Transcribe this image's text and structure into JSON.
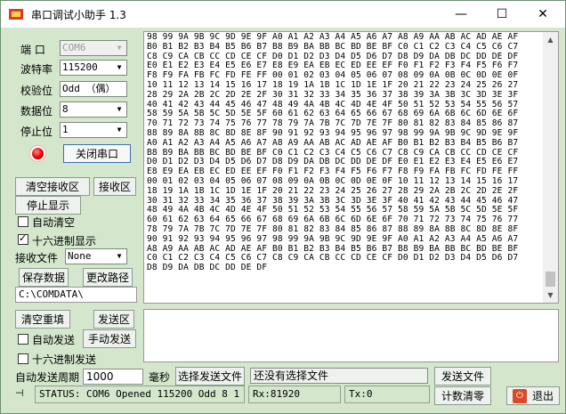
{
  "window": {
    "title": "串口调试小助手 1.3",
    "minimize_glyph": "—",
    "maximize_glyph": "☐",
    "close_glyph": "✕"
  },
  "settings": {
    "port_label": "端 口",
    "port_value": "COM6",
    "baud_label": "波特率",
    "baud_value": "115200",
    "parity_label": "校验位",
    "parity_value": "Odd （偶）",
    "databits_label": "数据位",
    "databits_value": "8",
    "stopbits_label": "停止位",
    "stopbits_value": "1",
    "close_port_button": "关闭串口"
  },
  "receive": {
    "clear_button": "清空接收区",
    "area_button": "接收区",
    "stop_button": "停止显示",
    "auto_clear_label": "自动清空",
    "auto_clear_checked": false,
    "hex_display_label": "十六进制显示",
    "hex_display_checked": true,
    "file_label": "接收文件",
    "file_value": "None",
    "save_button": "保存数据",
    "change_path_button": "更改路径",
    "path": "C:\\COMDATA\\",
    "lines": [
      "98 99 9A 9B 9C 9D 9E 9F A0 A1 A2 A3 A4 A5 A6 A7 A8 A9 AA AB AC AD AE AF",
      "B0 B1 B2 B3 B4 B5 B6 B7 B8 B9 BA BB BC BD BE BF C0 C1 C2 C3 C4 C5 C6 C7",
      "C8 C9 CA CB CC CD CE CF D0 D1 D2 D3 D4 D5 D6 D7 D8 D9 DA DB DC DD DE DF",
      "E0 E1 E2 E3 E4 E5 E6 E7 E8 E9 EA EB EC ED EE EF F0 F1 F2 F3 F4 F5 F6 F7",
      "F8 F9 FA FB FC FD FE FF 00 01 02 03 04 05 06 07 08 09 0A 0B 0C 0D 0E 0F",
      "10 11 12 13 14 15 16 17 18 19 1A 1B 1C 1D 1E 1F 20 21 22 23 24 25 26 27",
      "28 29 2A 2B 2C 2D 2E 2F 30 31 32 33 34 35 36 37 38 39 3A 3B 3C 3D 3E 3F",
      "40 41 42 43 44 45 46 47 48 49 4A 4B 4C 4D 4E 4F 50 51 52 53 54 55 56 57",
      "58 59 5A 5B 5C 5D 5E 5F 60 61 62 63 64 65 66 67 68 69 6A 6B 6C 6D 6E 6F",
      "70 71 72 73 74 75 76 77 78 79 7A 7B 7C 7D 7E 7F 80 81 82 83 84 85 86 87",
      "88 89 8A 8B 8C 8D 8E 8F 90 91 92 93 94 95 96 97 98 99 9A 9B 9C 9D 9E 9F",
      "A0 A1 A2 A3 A4 A5 A6 A7 A8 A9 AA AB AC AD AE AF B0 B1 B2 B3 B4 B5 B6 B7",
      "B8 B9 BA BB BC BD BE BF C0 C1 C2 C3 C4 C5 C6 C7 C8 C9 CA CB CC CD CE CF",
      "D0 D1 D2 D3 D4 D5 D6 D7 D8 D9 DA DB DC DD DE DF E0 E1 E2 E3 E4 E5 E6 E7",
      "E8 E9 EA EB EC ED EE EF F0 F1 F2 F3 F4 F5 F6 F7 F8 F9 FA FB FC FD FE FF",
      "00 01 02 03 04 05 06 07 08 09 0A 0B 0C 0D 0E 0F 10 11 12 13 14 15 16 17",
      "18 19 1A 1B 1C 1D 1E 1F 20 21 22 23 24 25 26 27 28 29 2A 2B 2C 2D 2E 2F",
      "30 31 32 33 34 35 36 37 38 39 3A 3B 3C 3D 3E 3F 40 41 42 43 44 45 46 47",
      "48 49 4A 4B 4C 4D 4E 4F 50 51 52 53 54 55 56 57 58 59 5A 5B 5C 5D 5E 5F",
      "60 61 62 63 64 65 66 67 68 69 6A 6B 6C 6D 6E 6F 70 71 72 73 74 75 76 77",
      "78 79 7A 7B 7C 7D 7E 7F 80 81 82 83 84 85 86 87 88 89 8A 8B 8C 8D 8E 8F",
      "90 91 92 93 94 95 96 97 98 99 9A 9B 9C 9D 9E 9F A0 A1 A2 A3 A4 A5 A6 A7",
      "A8 A9 AA AB AC AD AE AF B0 B1 B2 B3 B4 B5 B6 B7 B8 B9 BA BB BC BD BE BF",
      "C0 C1 C2 C3 C4 C5 C6 C7 C8 C9 CA CB CC CD CE CF D0 D1 D2 D3 D4 D5 D6 D7",
      "D8 D9 DA DB DC DD DE DF"
    ]
  },
  "send": {
    "clear_button": "清空重填",
    "area_button": "发送区",
    "auto_send_label": "自动发送",
    "auto_send_checked": false,
    "manual_send_button": "手动发送",
    "hex_send_label": "十六进制发送",
    "hex_send_checked": false,
    "period_label": "自动发送周期",
    "period_value": "1000",
    "period_unit": "毫秒",
    "choose_file_button": "选择发送文件",
    "file_status": "还没有选择文件",
    "send_file_button": "发送文件",
    "reset_count_button": "计数清零",
    "exit_button": "退出"
  },
  "status": {
    "text": "STATUS: COM6 Opened 115200 Odd  8 1",
    "rx": "Rx:81920",
    "tx": "Tx:0"
  },
  "colors": {
    "panel_bg": "#d4e6cc",
    "led_red": "#e00000"
  }
}
